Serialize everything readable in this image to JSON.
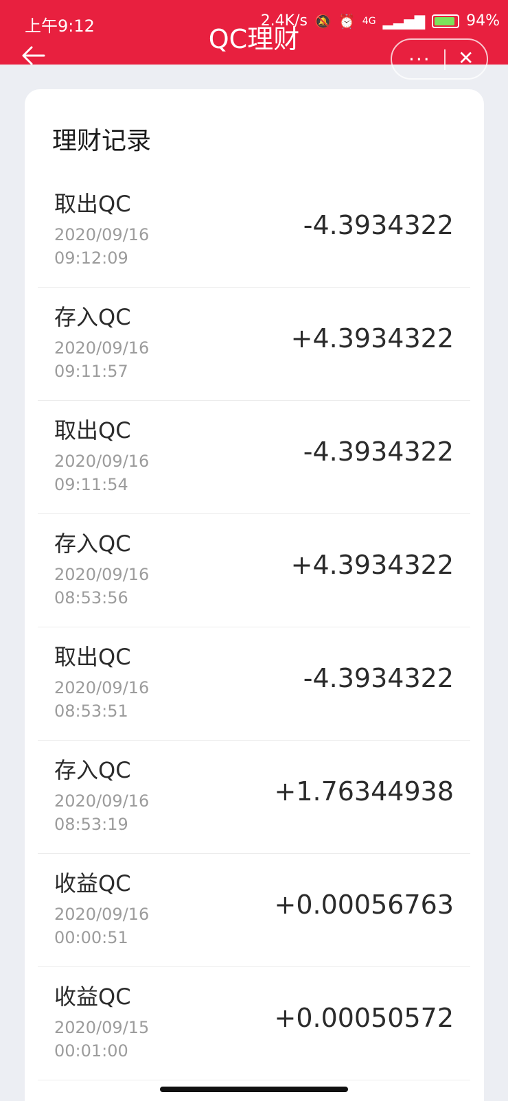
{
  "status_bar": {
    "time": "上午9:12",
    "net_speed": "2.4K/s",
    "network": "4G",
    "battery": "94%"
  },
  "header": {
    "title": "QC理财",
    "back_icon": "arrow-left-icon",
    "more_label": "···",
    "close_label": "✕"
  },
  "records": {
    "title": "理财记录",
    "items": [
      {
        "type": "取出QC",
        "date": "2020/09/16",
        "time": "09:12:09",
        "amount": "-4.3934322"
      },
      {
        "type": "存入QC",
        "date": "2020/09/16",
        "time": "09:11:57",
        "amount": "+4.3934322"
      },
      {
        "type": "取出QC",
        "date": "2020/09/16",
        "time": "09:11:54",
        "amount": "-4.3934322"
      },
      {
        "type": "存入QC",
        "date": "2020/09/16",
        "time": "08:53:56",
        "amount": "+4.3934322"
      },
      {
        "type": "取出QC",
        "date": "2020/09/16",
        "time": "08:53:51",
        "amount": "-4.3934322"
      },
      {
        "type": "存入QC",
        "date": "2020/09/16",
        "time": "08:53:19",
        "amount": "+1.76344938"
      },
      {
        "type": "收益QC",
        "date": "2020/09/16",
        "time": "00:00:51",
        "amount": "+0.00056763"
      },
      {
        "type": "收益QC",
        "date": "2020/09/15",
        "time": "00:01:00",
        "amount": "+0.00050572"
      }
    ]
  },
  "colors": {
    "header_bg": "#e8203f",
    "battery_fill": "#7be35b"
  }
}
